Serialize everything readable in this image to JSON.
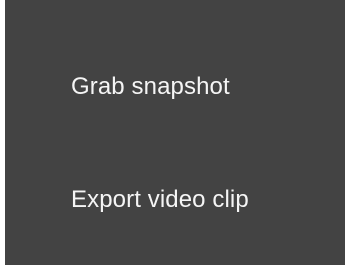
{
  "menu": {
    "items": [
      {
        "label": "Grab snapshot"
      },
      {
        "label": "Export video clip"
      }
    ]
  }
}
